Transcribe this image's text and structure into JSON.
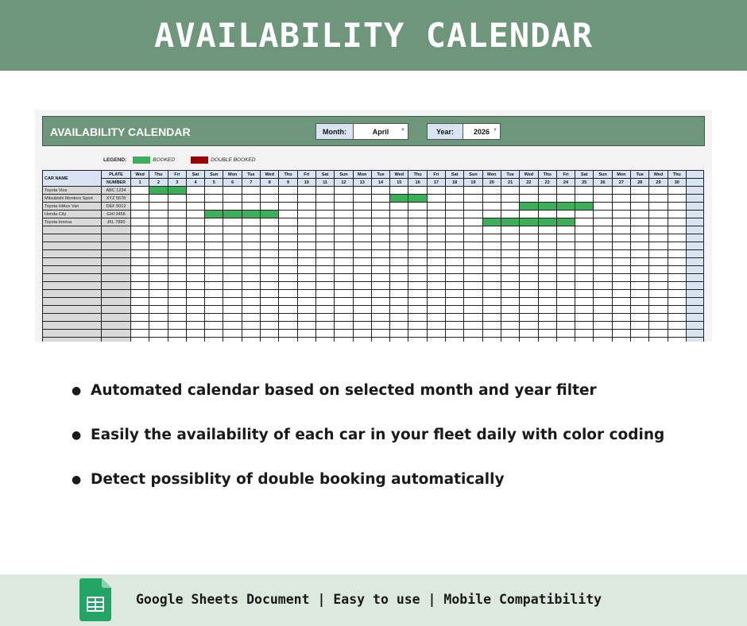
{
  "banner": {
    "title": "AVAILABILITY CALENDAR"
  },
  "sheet": {
    "title": "AVAILABILITY CALENDAR",
    "month_label": "Month:",
    "month_value": "April",
    "year_label": "Year:",
    "year_value": "2026",
    "legend": {
      "label": "LEGEND:",
      "booked": "BOOKED",
      "double_booked": "DOUBLE BOOKED",
      "booked_color": "#3dae5a",
      "double_color": "#9b0000"
    },
    "columns": {
      "car_name": "CAR NAME",
      "plate_line1": "PLATE",
      "plate_line2": "NUMBER"
    },
    "days": [
      {
        "dow": "Wed",
        "num": "1"
      },
      {
        "dow": "Thu",
        "num": "2"
      },
      {
        "dow": "Fri",
        "num": "3"
      },
      {
        "dow": "Sat",
        "num": "4"
      },
      {
        "dow": "Sun",
        "num": "5"
      },
      {
        "dow": "Mon",
        "num": "6"
      },
      {
        "dow": "Tue",
        "num": "7"
      },
      {
        "dow": "Wed",
        "num": "8"
      },
      {
        "dow": "Thu",
        "num": "9"
      },
      {
        "dow": "Fri",
        "num": "10"
      },
      {
        "dow": "Sat",
        "num": "11"
      },
      {
        "dow": "Sun",
        "num": "12"
      },
      {
        "dow": "Mon",
        "num": "13"
      },
      {
        "dow": "Tue",
        "num": "14"
      },
      {
        "dow": "Wed",
        "num": "15"
      },
      {
        "dow": "Thu",
        "num": "16"
      },
      {
        "dow": "Fri",
        "num": "17"
      },
      {
        "dow": "Sat",
        "num": "18"
      },
      {
        "dow": "Sun",
        "num": "19"
      },
      {
        "dow": "Mon",
        "num": "20"
      },
      {
        "dow": "Tue",
        "num": "21"
      },
      {
        "dow": "Wed",
        "num": "22"
      },
      {
        "dow": "Thu",
        "num": "23"
      },
      {
        "dow": "Fri",
        "num": "24"
      },
      {
        "dow": "Sat",
        "num": "25"
      },
      {
        "dow": "Sun",
        "num": "26"
      },
      {
        "dow": "Mon",
        "num": "27"
      },
      {
        "dow": "Tue",
        "num": "28"
      },
      {
        "dow": "Wed",
        "num": "29"
      },
      {
        "dow": "Thu",
        "num": "30"
      }
    ],
    "cars": [
      {
        "name": "Toyota Vios",
        "plate": "ABC 1234",
        "booked": [
          2,
          3
        ]
      },
      {
        "name": "Mitsubishi Montero Sport",
        "plate": "XYZ 5678",
        "booked": [
          15,
          16
        ]
      },
      {
        "name": "Toyota HiAce Van",
        "plate": "DEF 9012",
        "booked": [
          22,
          23,
          24,
          25
        ]
      },
      {
        "name": "Honda City",
        "plate": "GHI 3456",
        "booked": [
          5,
          6,
          7,
          8
        ]
      },
      {
        "name": "Toyota Innova",
        "plate": "JKL 7890",
        "booked": [
          20,
          21,
          22,
          23,
          24
        ]
      }
    ],
    "empty_rows": 17
  },
  "features": [
    "Automated calendar based on selected month and year filter",
    "Easily the availability of each car in your fleet daily with color coding",
    "Detect possiblity of double booking automatically"
  ],
  "footer": {
    "icon": "google-sheets-icon",
    "text": "Google Sheets Document | Easy to use | Mobile Compatibility"
  }
}
